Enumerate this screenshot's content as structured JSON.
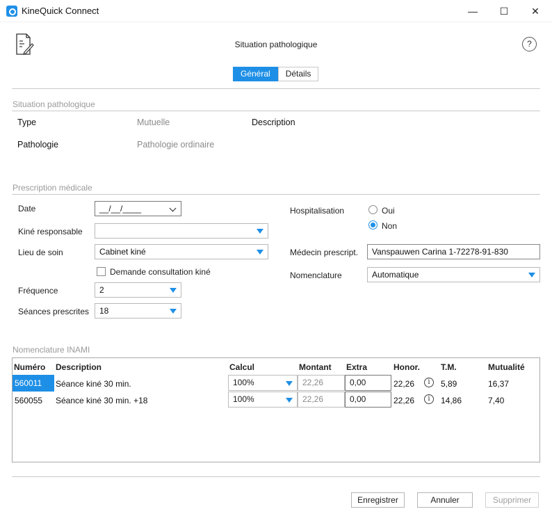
{
  "window": {
    "title": "KineQuick Connect",
    "minimize": "—",
    "maximize": "☐",
    "close": "✕"
  },
  "header": {
    "title": "Situation pathologique",
    "help": "?"
  },
  "tabs": [
    {
      "label": "Général",
      "active": true
    },
    {
      "label": "Détails",
      "active": false
    }
  ],
  "situation": {
    "section_label": "Situation pathologique",
    "type_label": "Type",
    "type_value": "Mutuelle",
    "description_label": "Description",
    "pathologie_label": "Pathologie",
    "pathologie_value": "Pathologie ordinaire"
  },
  "prescription": {
    "section_label": "Prescription médicale",
    "date_label": "Date",
    "date_value": "__/__/____",
    "kine_label": "Kiné responsable",
    "kine_value": "",
    "lieu_label": "Lieu de soin",
    "lieu_value": "Cabinet kiné",
    "demande_label": "Demande consultation kiné",
    "frequence_label": "Fréquence",
    "frequence_value": "2",
    "seances_label": "Séances prescrites",
    "seances_value": "18",
    "hospitalisation_label": "Hospitalisation",
    "oui_label": "Oui",
    "non_label": "Non",
    "hospitalisation_selected": "Non",
    "medecin_label": "Médecin prescript.",
    "medecin_value": "Vanspauwen Carina  1-72278-91-830",
    "nomenclature_label": "Nomenclature",
    "nomenclature_value": "Automatique"
  },
  "inami": {
    "section_label": "Nomenclature INAMI",
    "headers": {
      "numero": "Numéro",
      "description": "Description",
      "calcul": "Calcul",
      "montant": "Montant",
      "extra": "Extra",
      "honor": "Honor.",
      "tm": "T.M.",
      "mutualite": "Mutualité"
    },
    "rows": [
      {
        "numero": "560011",
        "description": "Séance kiné 30 min.",
        "calcul": "100%",
        "montant": "22,26",
        "extra": "0,00",
        "honor": "22,26",
        "info": "i",
        "tm": "5,89",
        "mutualite": "16,37"
      },
      {
        "numero": "560055",
        "description": "Séance kiné 30 min. +18",
        "calcul": "100%",
        "montant": "22,26",
        "extra": "0,00",
        "honor": "22,26",
        "info": "i",
        "tm": "14,86",
        "mutualite": "7,40"
      }
    ]
  },
  "footer": {
    "save": "Enregistrer",
    "cancel": "Annuler",
    "delete": "Supprimer"
  },
  "colors": {
    "accent": "#1e8fe6"
  }
}
